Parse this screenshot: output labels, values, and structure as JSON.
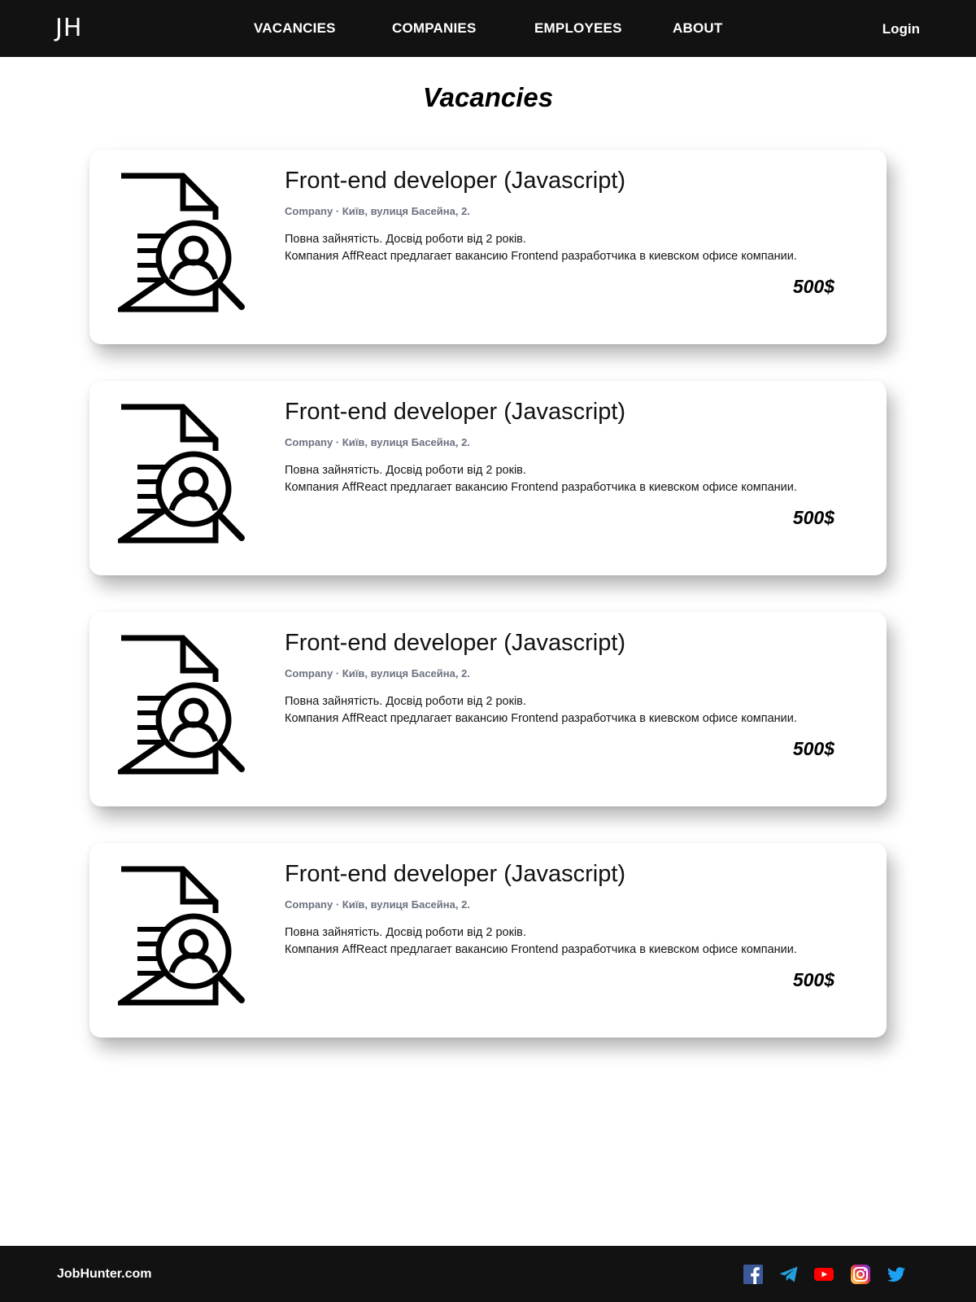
{
  "header": {
    "logo": "JH",
    "nav": [
      "VACANCIES",
      "COMPANIES",
      "EMPLOYEES",
      "ABOUT"
    ],
    "login": "Login"
  },
  "page": {
    "title": "Vacancies"
  },
  "vacancies": [
    {
      "title": "Front-end developer (Javascript)",
      "meta": "Company · Київ, вулиця Басейна, 2.",
      "desc_line1": "Повна зайнятість. Досвід роботи від 2 років.",
      "desc_line2": "Компания AffReact предлагает вакансию Frontend разработчика в киевском офисе компании.",
      "salary": "500$",
      "icon": "document-search-icon"
    },
    {
      "title": "Front-end developer (Javascript)",
      "meta": "Company · Київ, вулиця Басейна, 2.",
      "desc_line1": "Повна зайнятість. Досвід роботи від 2 років.",
      "desc_line2": "Компания AffReact предлагает вакансию Frontend разработчика в киевском офисе компании.",
      "salary": "500$",
      "icon": "document-search-icon"
    },
    {
      "title": "Front-end developer (Javascript)",
      "meta": "Company · Київ, вулиця Басейна, 2.",
      "desc_line1": "Повна зайнятість. Досвід роботи від 2 років.",
      "desc_line2": "Компания AffReact предлагает вакансию Frontend разработчика в киевском офисе компании.",
      "salary": "500$",
      "icon": "document-search-icon"
    },
    {
      "title": "Front-end developer (Javascript)",
      "meta": "Company · Київ, вулиця Басейна, 2.",
      "desc_line1": "Повна зайнятість. Досвід роботи від 2 років.",
      "desc_line2": "Компания AffReact предлагает вакансию Frontend разработчика в киевском офисе компании.",
      "salary": "500$",
      "icon": "document-search-icon"
    }
  ],
  "footer": {
    "brand": "JobHunter.com",
    "social_icons": [
      "facebook-icon",
      "telegram-icon",
      "youtube-icon",
      "instagram-icon",
      "twitter-icon"
    ]
  },
  "colors": {
    "header_bg": "#121212",
    "footer_bg": "#121212",
    "meta_text": "#6b7280",
    "facebook": "#3b5998",
    "telegram": "#229ed9",
    "youtube": "#ff0000",
    "twitter": "#1da1f2"
  }
}
